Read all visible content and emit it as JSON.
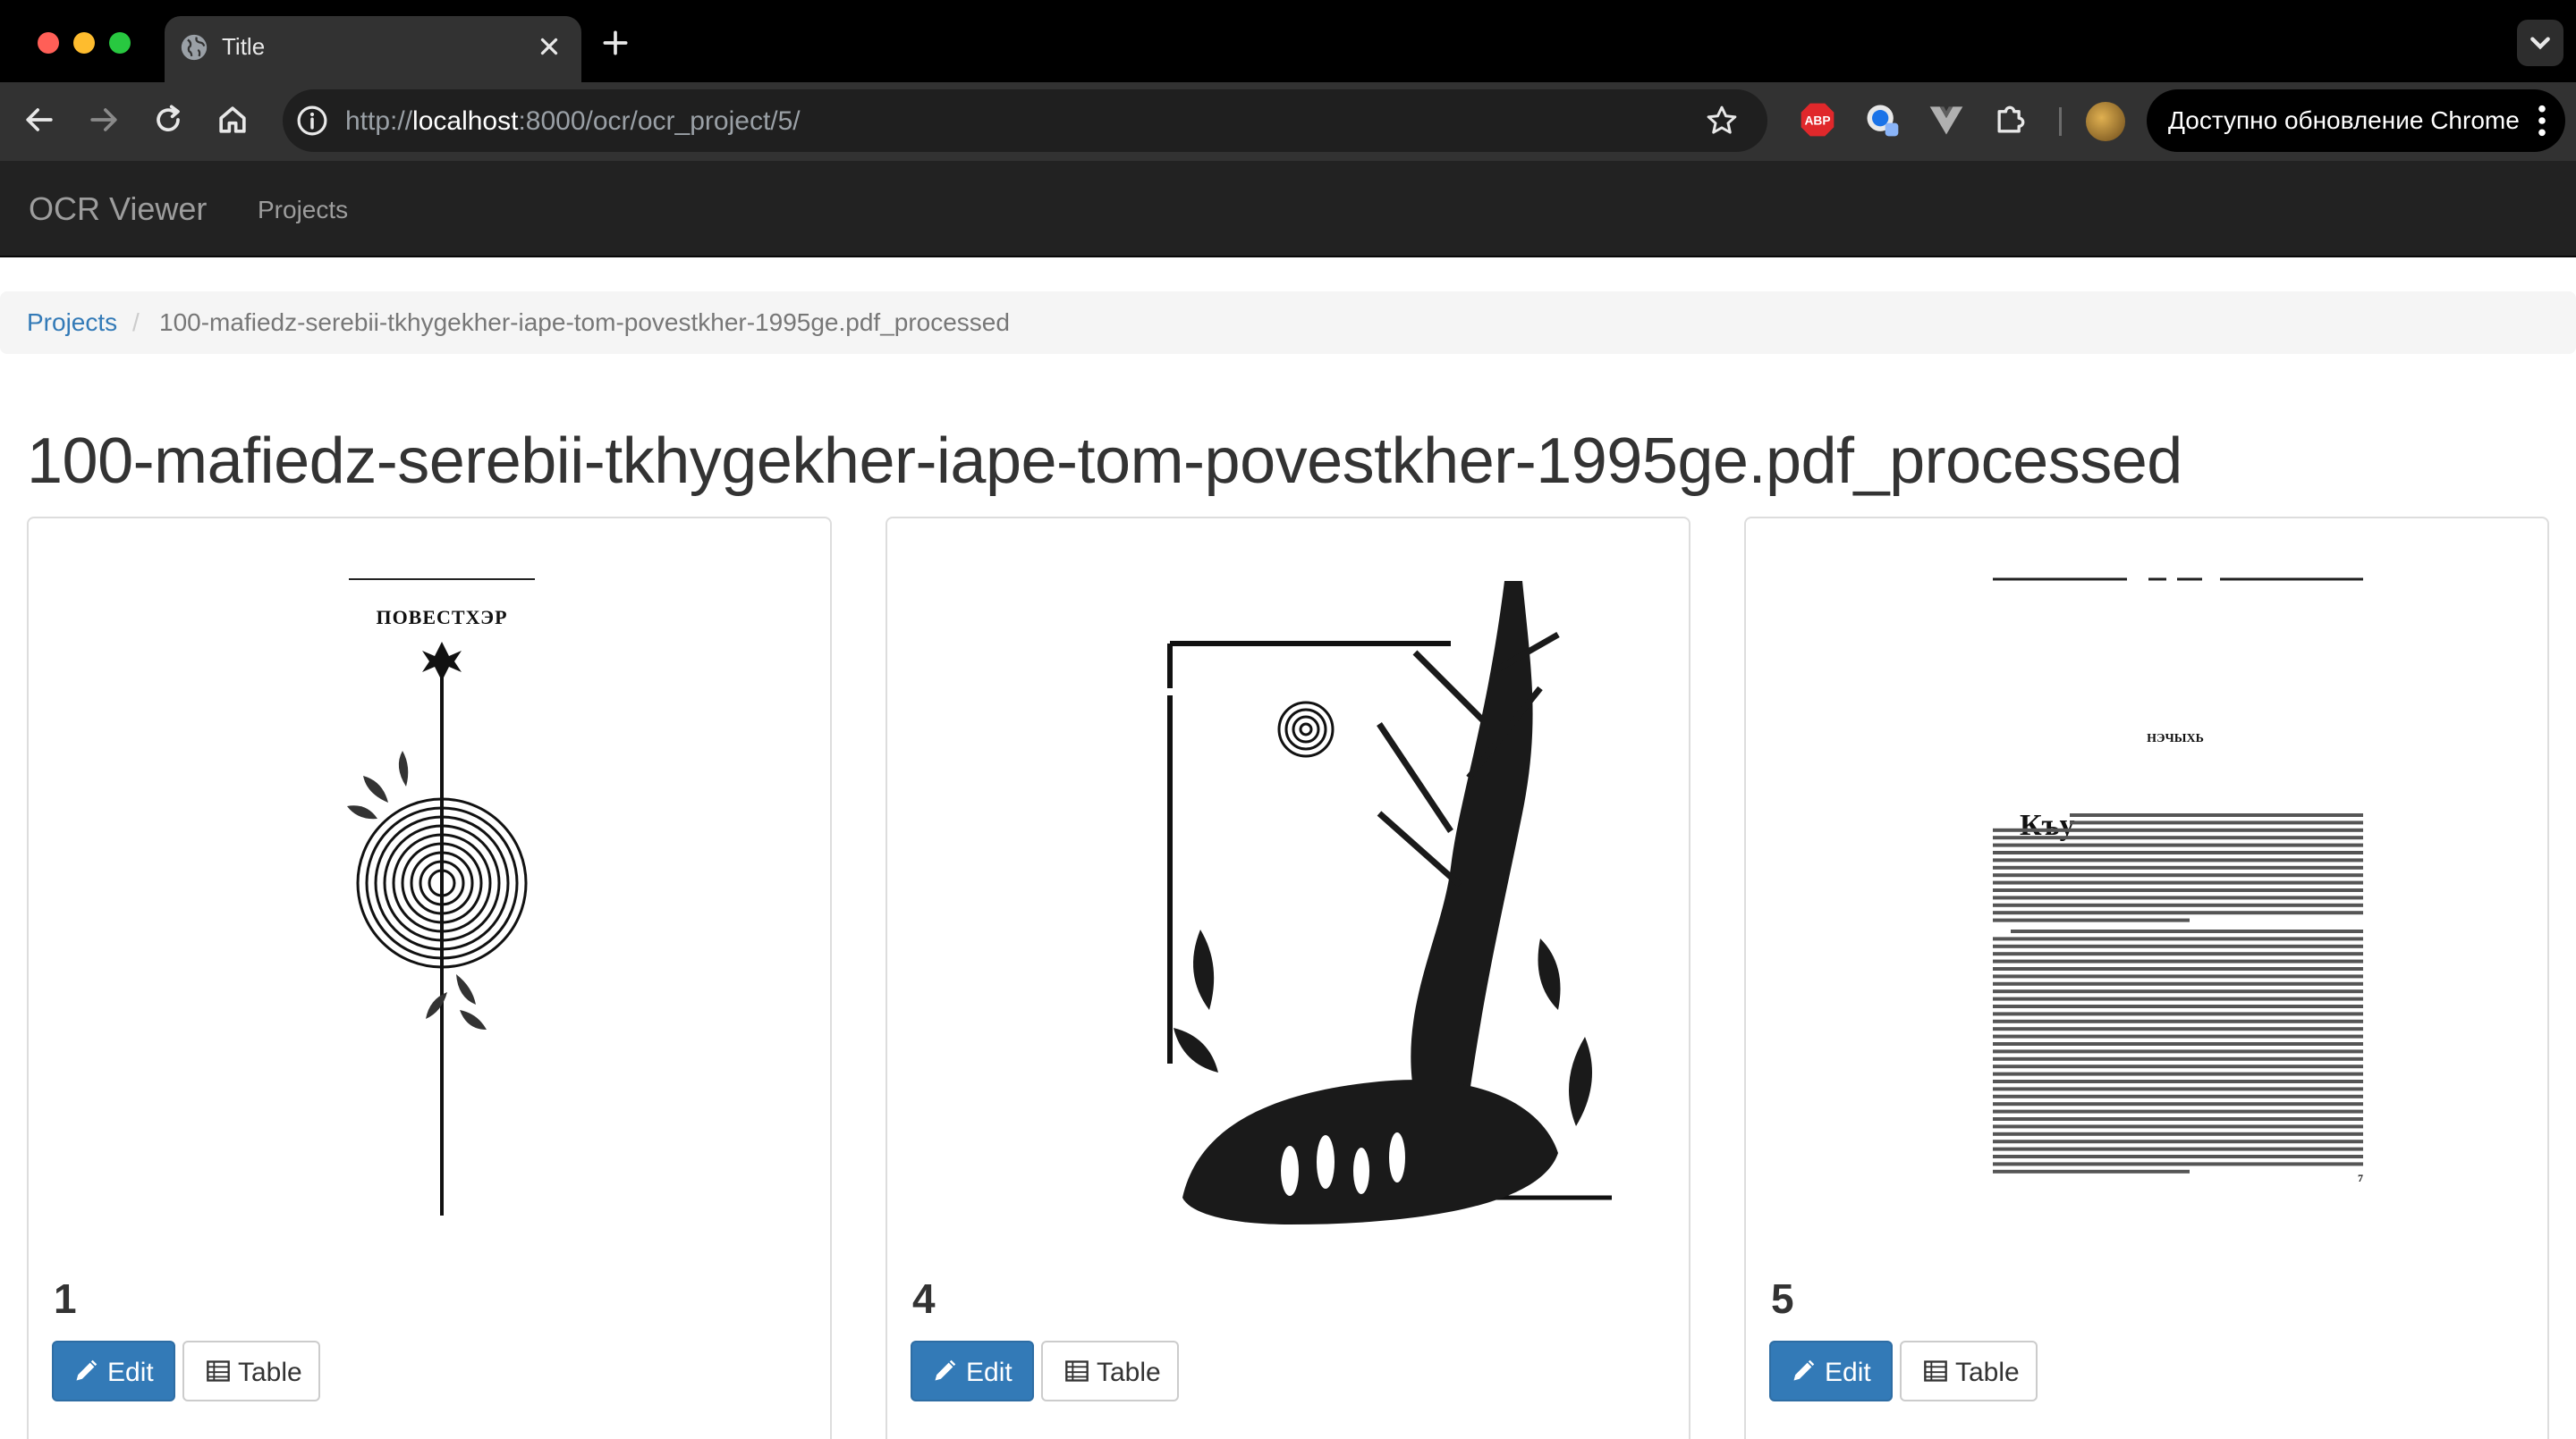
{
  "browser": {
    "tab_title": "Title",
    "url_prefix": "http://",
    "url_host": "localhost",
    "url_rest": ":8000/ocr/ocr_project/5/",
    "update_button": "Доступно обновление Chrome",
    "extensions": [
      "adblock-plus-icon",
      "translate-icon",
      "vuejs-devtools-icon",
      "puzzle-icon"
    ]
  },
  "navbar": {
    "brand": "OCR Viewer",
    "links": [
      "Projects"
    ]
  },
  "breadcrumb": {
    "root": "Projects",
    "separator": "/",
    "current": "100-mafiedz-serebii-tkhygekher-iape-tom-povestkher-1995ge.pdf_processed"
  },
  "page": {
    "title": "100-mafiedz-serebii-tkhygekher-iape-tom-povestkher-1995ge.pdf_processed"
  },
  "cards": [
    {
      "number": "1",
      "edit_label": "Edit",
      "table_label": "Table",
      "thumb": "title page with ornament, heading ПОВЕСТХЭР"
    },
    {
      "number": "4",
      "edit_label": "Edit",
      "table_label": "Table",
      "thumb": "ink illustration of tree and figures"
    },
    {
      "number": "5",
      "edit_label": "Edit",
      "table_label": "Table",
      "thumb": "text page"
    }
  ],
  "scans": {
    "p1_heading": "ПОВЕСТХЭР",
    "p3_heading": "НЭЧЫХЬ",
    "p3_dropcap": "Къу",
    "p3_pagenum": "7"
  },
  "colors": {
    "navbar_bg": "#222222",
    "link": "#337ab7",
    "primary": "#337ab7",
    "breadcrumb_bg": "#f5f5f5"
  }
}
